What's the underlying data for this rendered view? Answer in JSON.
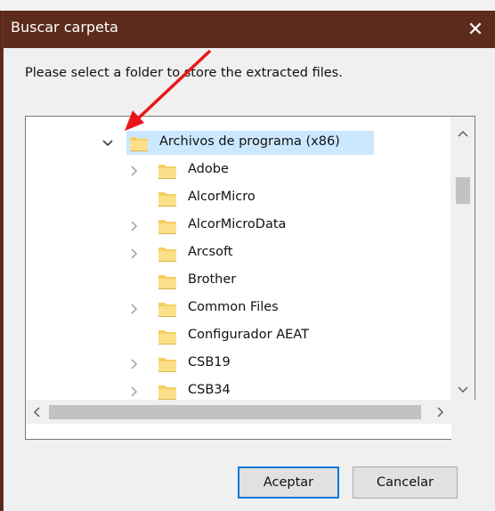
{
  "window": {
    "title": "Buscar carpeta",
    "close_glyph": "✕",
    "instruction": "Please select a folder to store the extracted files."
  },
  "tree": {
    "items": [
      {
        "label": "Archivos de programa (x86)",
        "expander": "expanded",
        "selected": true,
        "level": 0
      },
      {
        "label": "Adobe",
        "expander": "collapsed",
        "level": 1
      },
      {
        "label": "AlcorMicro",
        "expander": "none",
        "level": 1
      },
      {
        "label": "AlcorMicroData",
        "expander": "collapsed",
        "level": 1
      },
      {
        "label": "Arcsoft",
        "expander": "collapsed",
        "level": 1
      },
      {
        "label": "Brother",
        "expander": "none",
        "level": 1
      },
      {
        "label": "Common Files",
        "expander": "collapsed",
        "level": 1
      },
      {
        "label": "Configurador AEAT",
        "expander": "none",
        "level": 1
      },
      {
        "label": "CSB19",
        "expander": "collapsed",
        "level": 1
      },
      {
        "label": "CSB34",
        "expander": "collapsed",
        "level": 1
      }
    ]
  },
  "buttons": {
    "ok": "Aceptar",
    "cancel": "Cancelar"
  },
  "icons": {
    "folder": "folder-icon",
    "expander_collapsed": "chevron-right-icon",
    "expander_expanded": "chevron-down-icon",
    "annotation": "red-arrow-annotation"
  },
  "colors": {
    "titlebar": "#5c2b1b",
    "selection": "#cce8ff",
    "default_button_border": "#0078d7",
    "annotation_arrow": "#e8161b",
    "folder": "#f5cf62"
  }
}
